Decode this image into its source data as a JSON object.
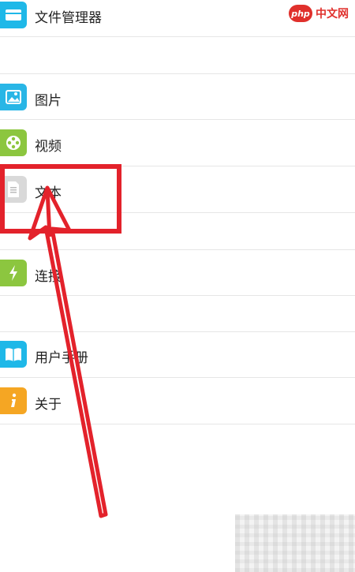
{
  "menu": {
    "file_manager": "文件管理器",
    "pictures": "图片",
    "videos": "视频",
    "text": "文本",
    "connect": "连接",
    "user_manual": "用户手册",
    "about": "关于"
  },
  "watermark": {
    "logo": "php",
    "text": "中文网"
  },
  "colors": {
    "file_manager_icon": "#1fb8e8",
    "pictures_icon": "#29b6e6",
    "videos_icon": "#8cc63f",
    "text_icon": "#d9d9d9",
    "connect_icon": "#8cc63f",
    "user_manual_icon": "#1fb8e8",
    "about_icon": "#f5a623",
    "annotation": "#e3222b"
  },
  "icons": {
    "file_manager": "folder-icon",
    "pictures": "image-icon",
    "videos": "film-reel-icon",
    "text": "document-icon",
    "connect": "lightning-icon",
    "user_manual": "book-icon",
    "about": "info-icon"
  }
}
